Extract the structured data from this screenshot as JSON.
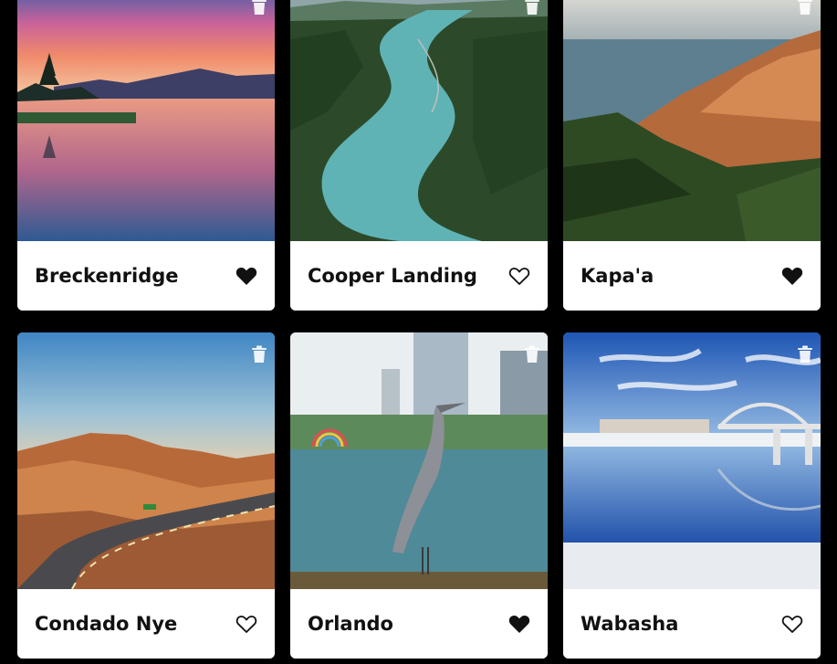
{
  "cards": [
    {
      "title": "Breckenridge",
      "favorited": true,
      "image": "sunset-lake-icon"
    },
    {
      "title": "Cooper Landing",
      "favorited": false,
      "image": "river-aerial-icon"
    },
    {
      "title": "Kapa'a",
      "favorited": true,
      "image": "coastal-cliffs-icon"
    },
    {
      "title": "Condado Nye",
      "favorited": false,
      "image": "desert-road-icon"
    },
    {
      "title": "Orlando",
      "favorited": true,
      "image": "heron-lake-icon"
    },
    {
      "title": "Wabasha",
      "favorited": false,
      "image": "bridge-reflection-icon"
    }
  ],
  "colors": {
    "background": "#000000",
    "card": "#ffffff",
    "title": "#111111",
    "heart": "#111111"
  },
  "icons": {
    "delete": "trash-icon",
    "favorite_on": "heart-filled-icon",
    "favorite_off": "heart-outline-icon"
  }
}
